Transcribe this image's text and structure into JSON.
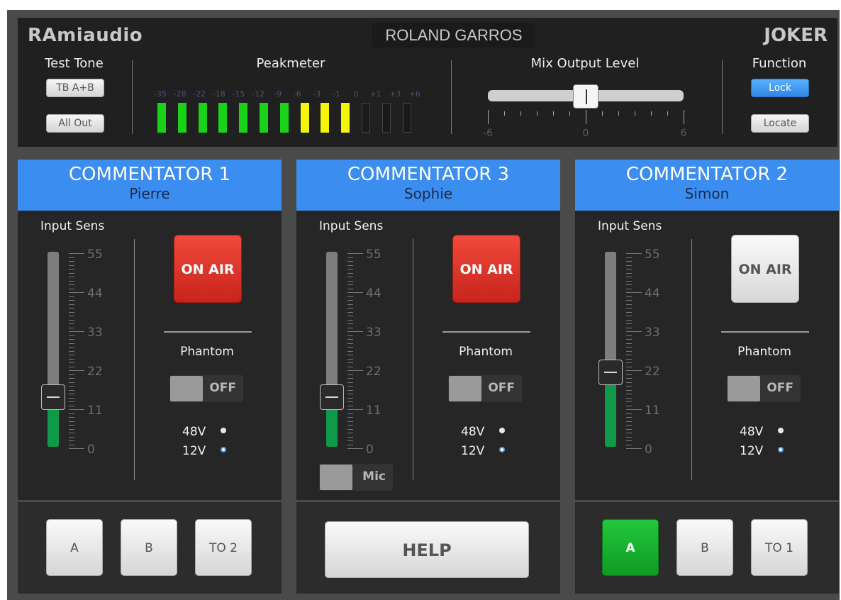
{
  "header": {
    "logo": "RAmiaudio",
    "station": "ROLAND GARROS",
    "model": "JOKER"
  },
  "test_tone": {
    "label": "Test Tone",
    "btn_tb": "TB A+B",
    "btn_all_out": "All Out"
  },
  "peakmeter": {
    "label": "Peakmeter",
    "scale": [
      "-35",
      "-28",
      "-22",
      "-18",
      "-15",
      "-12",
      "-9",
      "-6",
      "-3",
      "-1",
      "0",
      "+1",
      "+3",
      "+6"
    ],
    "lit_green": 7,
    "lit_yellow": 3,
    "total_segments": 13,
    "colors": {
      "green": "#19d219",
      "yellow": "#f5f50a",
      "off": "#1a1a1a"
    }
  },
  "mix_output": {
    "label": "Mix Output Level",
    "min": "-6",
    "mid": "0",
    "max": "6",
    "value": 0
  },
  "function": {
    "label": "Function",
    "btn_lock": "Lock",
    "btn_locate": "Locate"
  },
  "channels": [
    {
      "title": "COMMENTATOR 1",
      "name": "Pierre",
      "input_label": "Input Sens",
      "scale": [
        "55",
        "44",
        "33",
        "22",
        "11",
        "0"
      ],
      "input_value": 14,
      "on_air_label": "ON AIR",
      "on_air": true,
      "phantom_label": "Phantom",
      "phantom_state": "OFF",
      "v48": "48V",
      "v12": "12V",
      "buttons": [
        "A",
        "B",
        "TO 2"
      ]
    },
    {
      "title": "COMMENTATOR 3",
      "name": "Sophie",
      "input_label": "Input Sens",
      "scale": [
        "55",
        "44",
        "33",
        "22",
        "11",
        "0"
      ],
      "input_value": 14,
      "on_air_label": "ON AIR",
      "on_air": true,
      "phantom_label": "Phantom",
      "phantom_state": "OFF",
      "v48": "48V",
      "v12": "12V",
      "mic_label": "Mic",
      "help_label": "HELP"
    },
    {
      "title": "COMMENTATOR 2",
      "name": "Simon",
      "input_label": "Input Sens",
      "scale": [
        "55",
        "44",
        "33",
        "22",
        "11",
        "0"
      ],
      "input_value": 21,
      "on_air_label": "ON AIR",
      "on_air": false,
      "phantom_label": "Phantom",
      "phantom_state": "OFF",
      "v48": "48V",
      "v12": "12V",
      "buttons": [
        "A",
        "B",
        "TO 1"
      ],
      "active_button": "A"
    }
  ]
}
